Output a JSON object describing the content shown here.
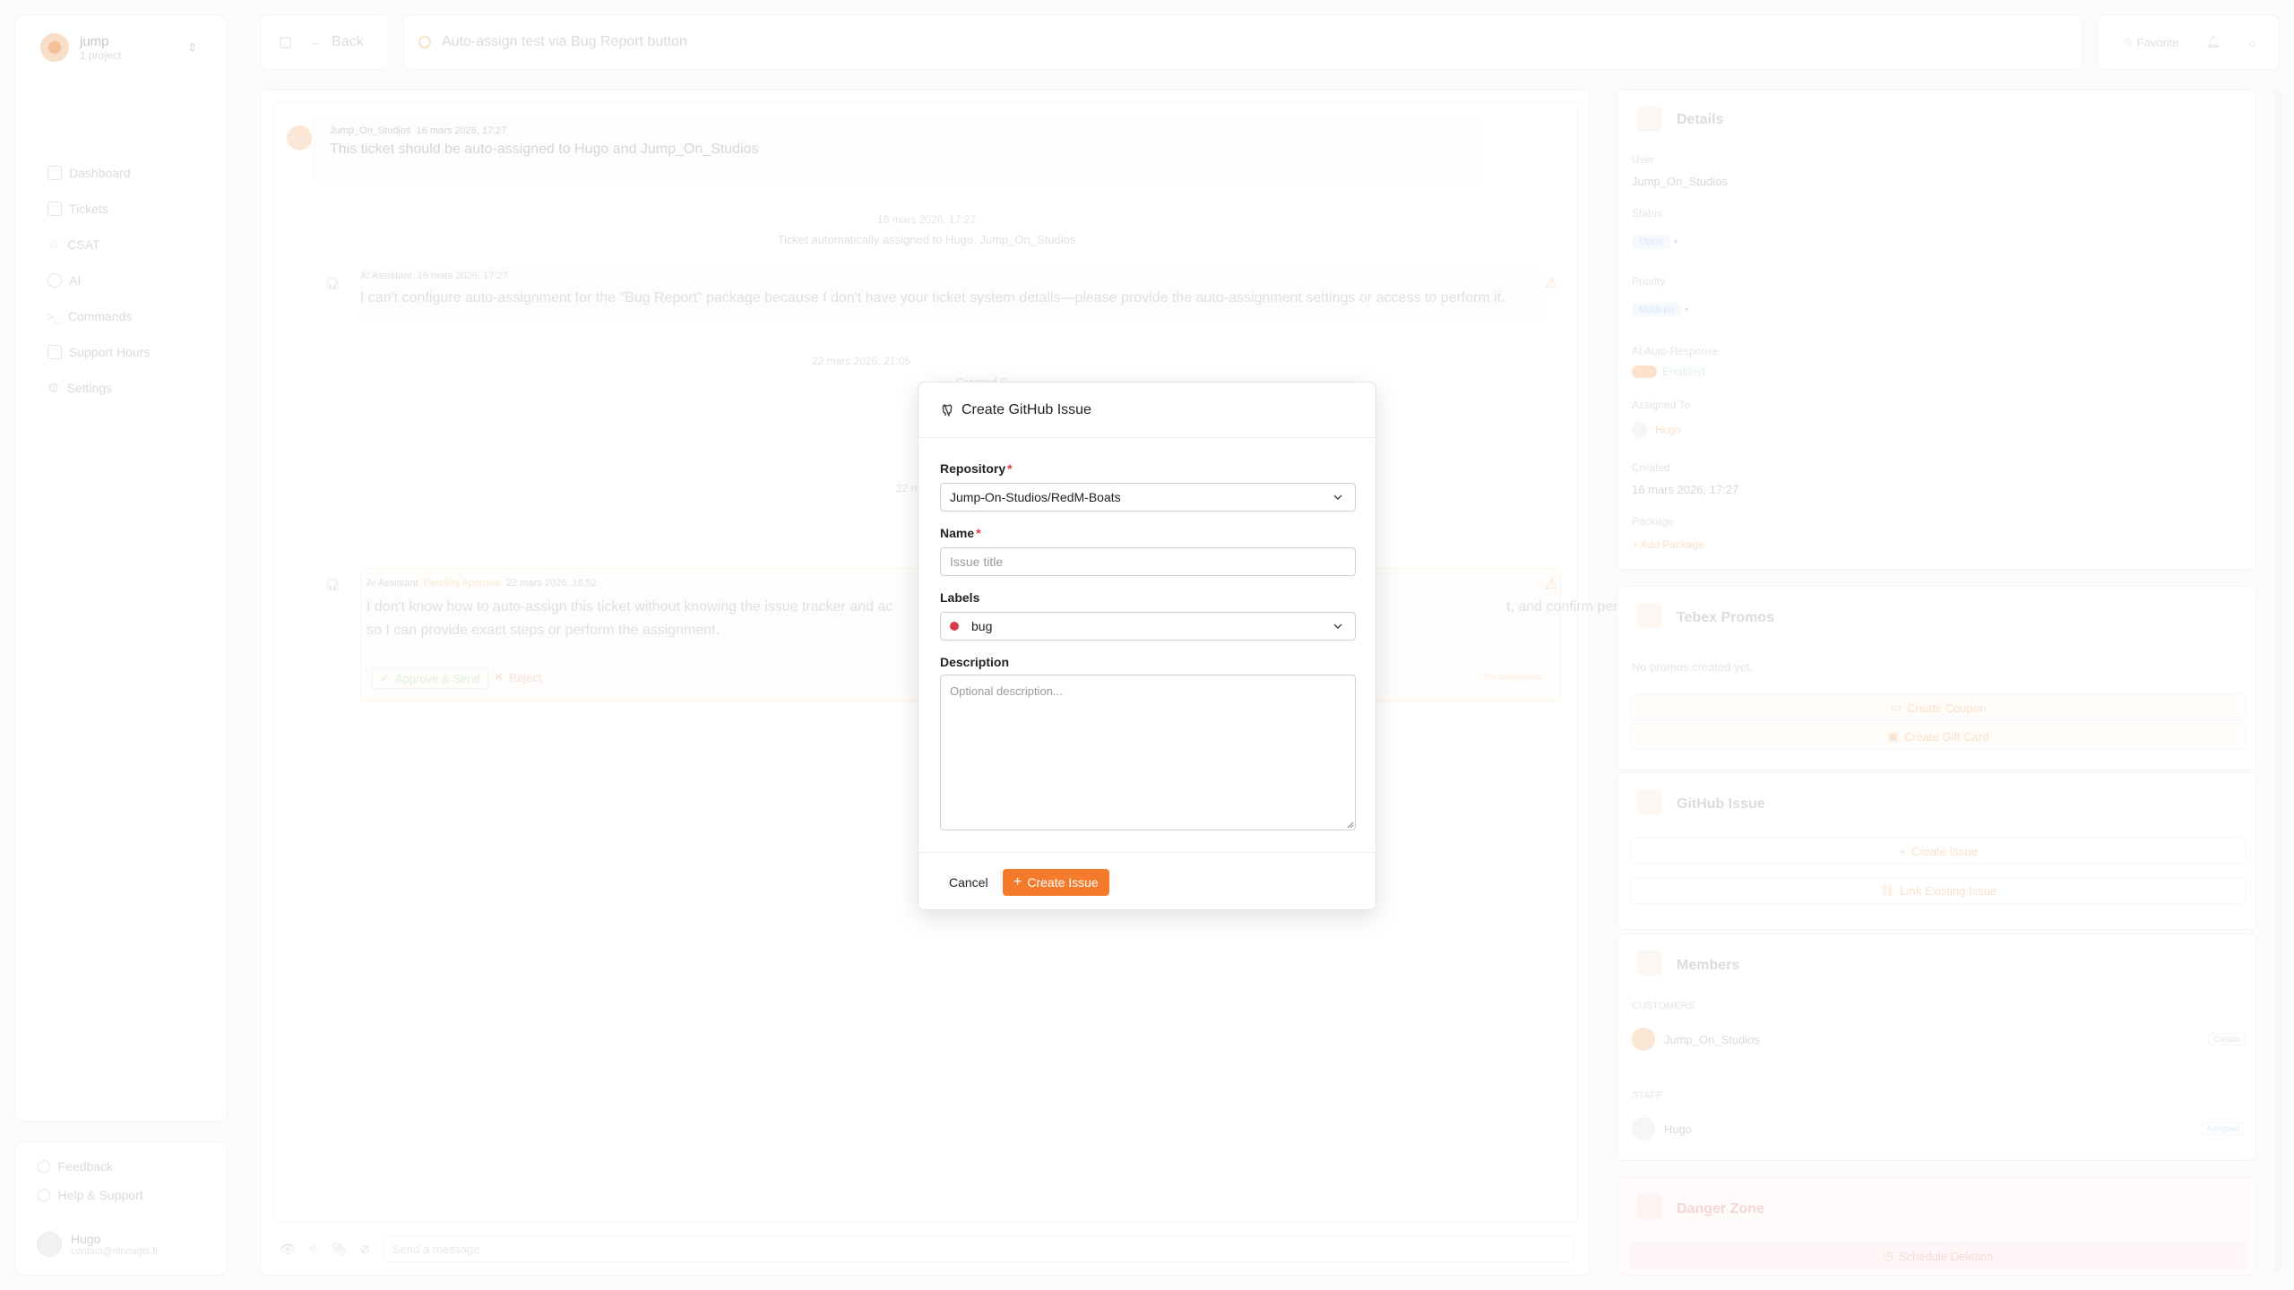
{
  "workspace": {
    "name": "jump",
    "subtitle": "1 project"
  },
  "sidebar": {
    "items": [
      {
        "label": "Dashboard",
        "icon": "grid-icon"
      },
      {
        "label": "Tickets",
        "icon": "ticket-icon"
      },
      {
        "label": "CSAT",
        "icon": "star-icon"
      },
      {
        "label": "AI",
        "icon": "info-icon"
      },
      {
        "label": "Commands",
        "icon": "terminal-icon"
      },
      {
        "label": "Support Hours",
        "icon": "calendar-icon"
      },
      {
        "label": "Settings",
        "icon": "gear-icon"
      }
    ],
    "feedback_label": "Feedback",
    "help_label": "Help & Support",
    "user_name": "Hugo",
    "user_email": "contact@nineagts.fr"
  },
  "topbar": {
    "back_label": "Back",
    "ticket_title": "Auto-assign test via Bug Report button",
    "favorite_label": "Favorite"
  },
  "chat": {
    "msg1_author": "Jump_On_Studios",
    "msg1_time": "16 mars 2026, 17:27",
    "msg1_text": "This ticket should be auto-assigned to Hugo and Jump_On_Studios",
    "sys1_time": "16 mars 2026, 17:27",
    "sys1_text": "Ticket automatically assigned to Hugo, Jump_On_Studios",
    "ai1_author": "AI Assistant",
    "ai1_time": "16 mars 2026, 17:27",
    "ai1_text": "I can't configure auto-assignment for the \"Bug Report\" package because I don't have your ticket system details—please provide the auto-assignment settings or access to perform it.",
    "sys2_time": "22 mars 2026, 21:05",
    "sys2_lines": [
      "Created G",
      "Title:",
      "Description: H",
      "Labels: bug"
    ],
    "sys3_time": "22 mar",
    "sys3_lines": [
      "Unlinked fro",
      "Title:"
    ],
    "ai2_author": "AI Assistant",
    "ai2_time": "22 mars 2026, 18:52",
    "ai2_status": "Pending Approval",
    "ai2_text_a": "I don't know how to auto-assign this ticket without knowing the issue tracker and ac",
    "ai2_text_b": "t, and confirm permissions",
    "ai2_text_c": "so I can provide exact steps or perform the assignment.",
    "approve_label": "Approve & Send",
    "reject_label": "Reject",
    "ai2_confidence": "0% confidence",
    "composer_placeholder": "Send a message"
  },
  "details": {
    "title": "Details",
    "user_label": "User",
    "user_value": "Jump_On_Studios",
    "status_label": "Status",
    "status_value": "Open",
    "priority_label": "Priority",
    "priority_value": "Medium",
    "ai_label": "AI Auto-Response",
    "ai_value": "Enabled",
    "assigned_label": "Assigned To",
    "assigned_value": "Hugo",
    "created_label": "Created",
    "created_value": "16 mars 2026, 17:27",
    "package_label": "Package",
    "add_package": "+ Add Package"
  },
  "promos": {
    "title": "Tebex Promos",
    "empty": "No promos created yet.",
    "create_coupon": "Create Coupon",
    "create_gift": "Create Gift Card"
  },
  "github_panel": {
    "title": "GitHub Issue",
    "create_issue": "Create Issue",
    "link_issue": "Link Existing Issue"
  },
  "members": {
    "title": "Members",
    "customers_label": "CUSTOMERS",
    "customer_name": "Jump_On_Studios",
    "customer_tag": "Creator",
    "staff_label": "STAFF",
    "staff_name": "Hugo",
    "staff_tag": "Assigned"
  },
  "danger": {
    "title": "Danger Zone",
    "schedule": "Schedule Deletion"
  },
  "modal": {
    "title": "Create GitHub Issue",
    "repo_label": "Repository",
    "repo_value": "Jump-On-Studios/RedM-Boats",
    "name_label": "Name",
    "name_placeholder": "Issue title",
    "labels_label": "Labels",
    "labels_value": "bug",
    "labels_color": "#d73a4a",
    "description_label": "Description",
    "description_placeholder": "Optional description...",
    "cancel_label": "Cancel",
    "create_label": "Create Issue"
  },
  "colors": {
    "accent": "#f47a2c",
    "required": "#e53935"
  }
}
